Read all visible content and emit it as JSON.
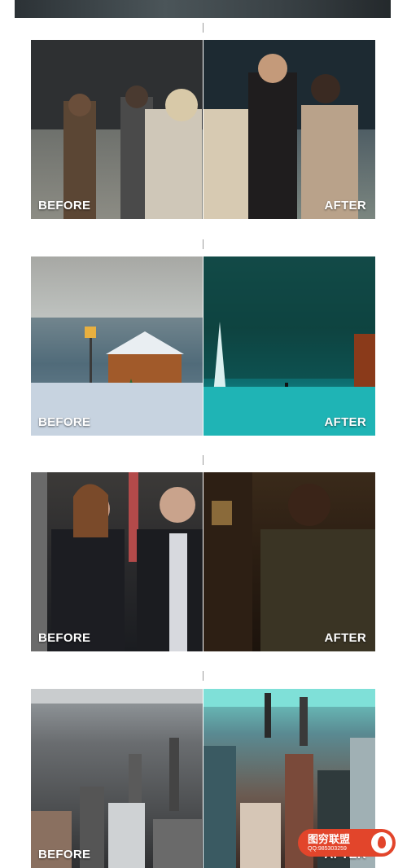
{
  "panels": [
    {
      "before_label": "BEFORE",
      "after_label": "AFTER"
    },
    {
      "before_label": "BEFORE",
      "after_label": "AFTER"
    },
    {
      "before_label": "BEFORE",
      "after_label": "AFTER"
    },
    {
      "before_label": "BEFORE",
      "after_label": "AFTER"
    }
  ],
  "watermark": {
    "brand": "图穷联盟",
    "qq": "QQ:985303259"
  },
  "colors": {
    "badge": "#e2452b",
    "background": "#ffffff"
  }
}
